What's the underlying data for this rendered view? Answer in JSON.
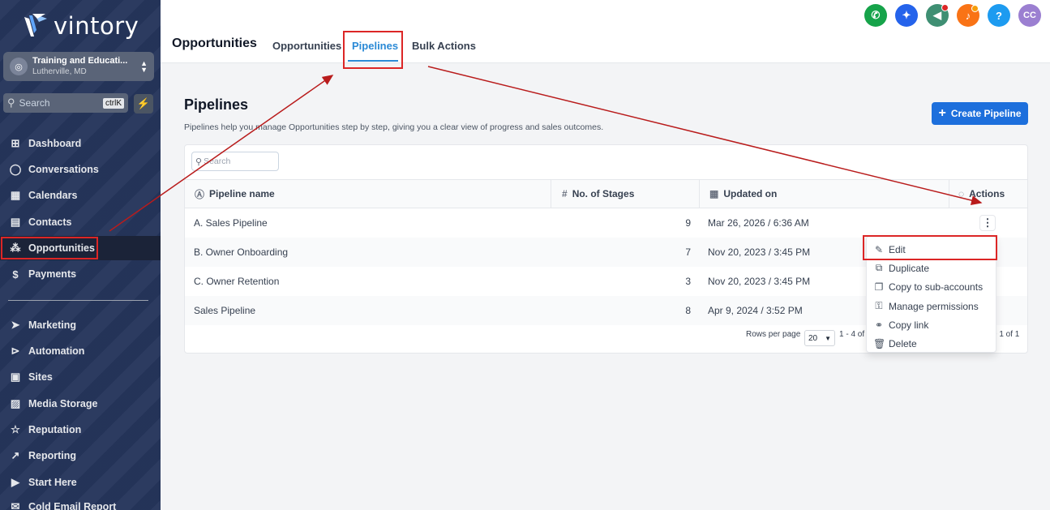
{
  "app": {
    "logo_text": "vintory"
  },
  "account": {
    "name": "Training and Educati...",
    "location": "Lutherville, MD"
  },
  "search": {
    "placeholder": "Search",
    "shortcut": "ctrlK"
  },
  "sidebar": {
    "items": [
      {
        "label": "Dashboard",
        "icon": "dashboard-icon"
      },
      {
        "label": "Conversations",
        "icon": "chat-icon"
      },
      {
        "label": "Calendars",
        "icon": "calendar-icon"
      },
      {
        "label": "Contacts",
        "icon": "contacts-icon"
      },
      {
        "label": "Opportunities",
        "icon": "opportunities-icon"
      },
      {
        "label": "Payments",
        "icon": "payments-icon"
      },
      {
        "label": "Marketing",
        "icon": "send-icon"
      },
      {
        "label": "Automation",
        "icon": "automation-icon"
      },
      {
        "label": "Sites",
        "icon": "sites-icon"
      },
      {
        "label": "Media Storage",
        "icon": "image-icon"
      },
      {
        "label": "Reputation",
        "icon": "star-icon"
      },
      {
        "label": "Reporting",
        "icon": "trend-icon"
      },
      {
        "label": "Start Here",
        "icon": "play-icon"
      },
      {
        "label": "Cold Email Report",
        "icon": "mail-icon"
      }
    ]
  },
  "header": {
    "title": "Opportunities",
    "tabs": [
      {
        "label": "Opportunities"
      },
      {
        "label": "Pipelines"
      },
      {
        "label": "Bulk Actions"
      }
    ],
    "avatar_initials": "CC",
    "help_label": "?"
  },
  "content": {
    "title": "Pipelines",
    "description": "Pipelines help you manage Opportunities step by step, giving you a clear view of progress and sales outcomes.",
    "create_button": "Create Pipeline",
    "table_search_placeholder": "Search",
    "columns": {
      "name": "Pipeline name",
      "stages": "No. of Stages",
      "updated": "Updated on",
      "actions": "Actions"
    },
    "rows": [
      {
        "name": "A. Sales Pipeline",
        "stages": "9",
        "updated": "Mar 26, 2026 / 6:36 AM"
      },
      {
        "name": "B. Owner Onboarding",
        "stages": "7",
        "updated": "Nov 20, 2023 / 3:45 PM"
      },
      {
        "name": "C. Owner Retention",
        "stages": "3",
        "updated": "Nov 20, 2023 / 3:45 PM"
      },
      {
        "name": "Sales Pipeline",
        "stages": "8",
        "updated": "Apr 9, 2024 / 3:52 PM"
      }
    ],
    "pager": {
      "rows_per_page_label": "Rows per page",
      "rows_per_page_value": "20",
      "range_text": "1 - 4 of",
      "page_text": "e 1 of 1"
    }
  },
  "actions_menu": {
    "items": [
      {
        "label": "Edit",
        "icon": "pencil-icon"
      },
      {
        "label": "Duplicate",
        "icon": "duplicate-icon"
      },
      {
        "label": "Copy to sub-accounts",
        "icon": "copy-icon"
      },
      {
        "label": "Manage permissions",
        "icon": "key-icon"
      },
      {
        "label": "Copy link",
        "icon": "link-icon"
      },
      {
        "label": "Delete",
        "icon": "trash-icon"
      }
    ]
  },
  "colors": {
    "sidebar_bg": "#25355b",
    "accent_blue": "#1d6fdc",
    "tab_active": "#2b8ad6",
    "highlight_red": "#dc2626"
  }
}
